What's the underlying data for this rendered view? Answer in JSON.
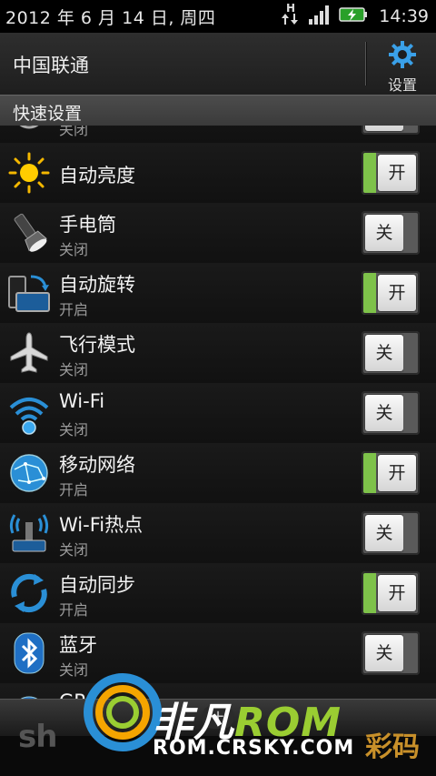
{
  "status_bar": {
    "date": "2012 年 6 月 14 日, 周四",
    "network_type": "H",
    "time": "14:39"
  },
  "header": {
    "carrier": "中国联通",
    "settings_label": "设置"
  },
  "section": {
    "title": "快速设置"
  },
  "items": [
    {
      "name": "",
      "state": "关闭",
      "toggle": "关",
      "on": false,
      "icon": "partial-icon"
    },
    {
      "name": "自动亮度",
      "state": "",
      "toggle": "开",
      "on": true,
      "icon": "brightness-icon"
    },
    {
      "name": "手电筒",
      "state": "关闭",
      "toggle": "关",
      "on": false,
      "icon": "flashlight-icon"
    },
    {
      "name": "自动旋转",
      "state": "开启",
      "toggle": "开",
      "on": true,
      "icon": "rotate-icon"
    },
    {
      "name": "飞行模式",
      "state": "关闭",
      "toggle": "关",
      "on": false,
      "icon": "airplane-icon"
    },
    {
      "name": "Wi-Fi",
      "state": "关闭",
      "toggle": "关",
      "on": false,
      "icon": "wifi-icon"
    },
    {
      "name": "移动网络",
      "state": "开启",
      "toggle": "开",
      "on": true,
      "icon": "globe-icon"
    },
    {
      "name": "Wi-Fi热点",
      "state": "关闭",
      "toggle": "关",
      "on": false,
      "icon": "hotspot-icon"
    },
    {
      "name": "自动同步",
      "state": "开启",
      "toggle": "开",
      "on": true,
      "icon": "sync-icon"
    },
    {
      "name": "蓝牙",
      "state": "关闭",
      "toggle": "关",
      "on": false,
      "icon": "bluetooth-icon"
    },
    {
      "name": "GP",
      "state": "",
      "toggle": "",
      "on": false,
      "icon": "gps-icon"
    }
  ],
  "watermark": {
    "left_text": "sh",
    "title_cn": "非凡",
    "title_rom": "ROM",
    "url": "ROM.CRSKY.COM",
    "right_text": "彩码"
  },
  "colors": {
    "toggle_on": "#7ec24a",
    "accent_blue": "#2a8fd6",
    "background": "#101010"
  }
}
